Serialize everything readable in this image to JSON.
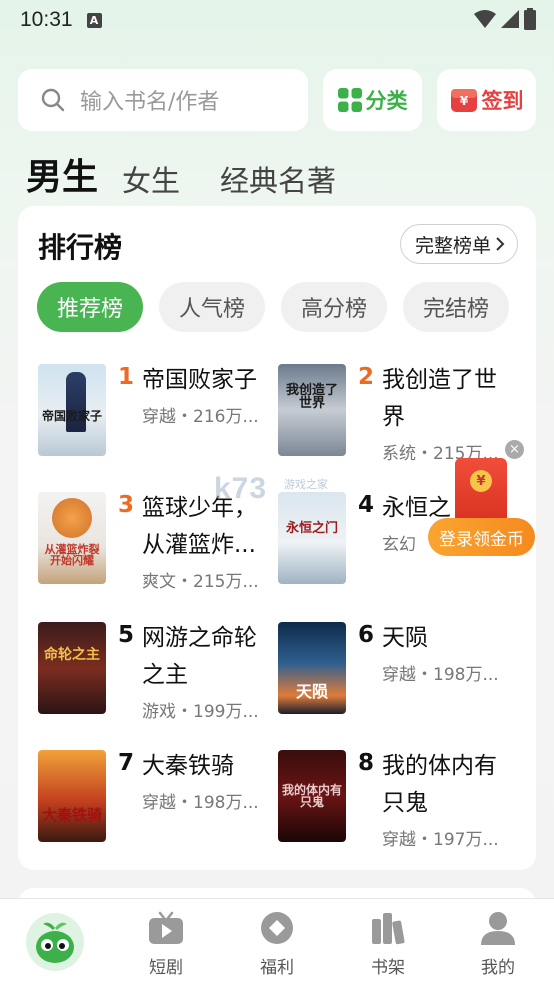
{
  "status": {
    "time": "10:31",
    "notification_icon": "A"
  },
  "search": {
    "placeholder": "输入书名/作者"
  },
  "actions": {
    "category_label": "分类",
    "signin_label": "签到"
  },
  "gender_tabs": [
    "男生",
    "女生",
    "经典名著"
  ],
  "ranking": {
    "title": "排行榜",
    "full_list_label": "完整榜单",
    "tabs": [
      "推荐榜",
      "人气榜",
      "高分榜",
      "完结榜"
    ],
    "books": [
      {
        "rank": "1",
        "title": "帝国败家子",
        "meta": "穿越・216万...",
        "cover_text": "帝国败家子"
      },
      {
        "rank": "2",
        "title": "我创造了世界",
        "meta": "系统・215万...",
        "cover_text": "我创造了世界"
      },
      {
        "rank": "3",
        "title": "篮球少年，从灌篮炸...",
        "meta": "爽文・215万...",
        "cover_text": "从灌篮炸裂开始闪耀"
      },
      {
        "rank": "4",
        "title": "永恒之",
        "meta": "玄幻",
        "cover_text": "永恒之门"
      },
      {
        "rank": "5",
        "title": "网游之命轮之主",
        "meta": "游戏・199万...",
        "cover_text": "命轮之主"
      },
      {
        "rank": "6",
        "title": "天陨",
        "meta": "穿越・198万...",
        "cover_text": "天陨"
      },
      {
        "rank": "7",
        "title": "大秦铁骑",
        "meta": "穿越・198万...",
        "cover_text": "大秦铁骑"
      },
      {
        "rank": "8",
        "title": "我的体内有只鬼",
        "meta": "穿越・197万...",
        "cover_text": "我的体内有只鬼"
      }
    ]
  },
  "promo": {
    "close_label": "×",
    "coin_symbol": "¥",
    "login_label": "登录领金币",
    "signin_symbol": "¥"
  },
  "watermark": {
    "main": "k73",
    "sub": "游戏之家"
  },
  "nav": {
    "items": [
      "短剧",
      "福利",
      "书架",
      "我的"
    ]
  },
  "colors": {
    "accent": "#48b552",
    "rank_highlight": "#ef6a1f",
    "signin": "#e64040",
    "promo": "#f58a1f"
  }
}
